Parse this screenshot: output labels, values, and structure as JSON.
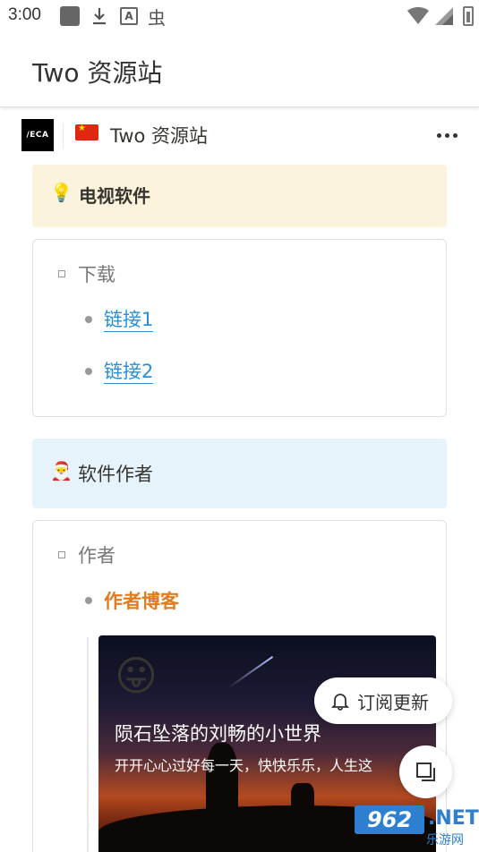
{
  "status_bar": {
    "time": "3:00",
    "text_icon_glyph": "A",
    "bug_icon_glyph": "虫"
  },
  "app_bar": {
    "title": "Two 资源站"
  },
  "page_header": {
    "logo_text": "/ECA",
    "title": "Two 资源站"
  },
  "callouts": {
    "tv": {
      "icon": "💡",
      "label": "电视软件",
      "bg": "#fbf3db"
    },
    "author": {
      "icon": "🎅",
      "label": "软件作者",
      "bg": "#e7f3fb"
    }
  },
  "download_block": {
    "toggle_label": "下载",
    "links": [
      "链接1",
      "链接2"
    ]
  },
  "author_block": {
    "toggle_label": "作者",
    "blog_label": "作者博客",
    "blog_card": {
      "emoji": "😛",
      "title": "陨石坠落的刘畅的小世界",
      "subtitle": "开开心心过好每一天，快快乐乐，人生这"
    }
  },
  "floating": {
    "subscribe_label": "订阅更新"
  },
  "watermark": {
    "number": "962",
    "net": ".NET",
    "site": "乐游网"
  },
  "colors": {
    "link": "#2a8fd6",
    "blog_link": "#e07b1f",
    "watermark": "#2e7fd0"
  }
}
